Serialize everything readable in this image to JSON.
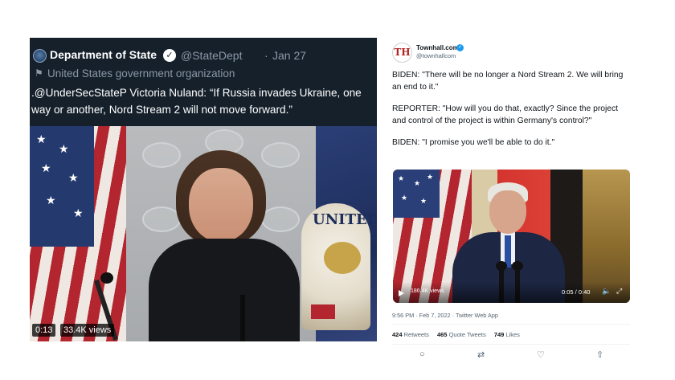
{
  "left_tweet": {
    "account_name": "Department of State",
    "verified_mark": "✓",
    "handle": "@StateDept",
    "separator": "·",
    "date": "Jan 27",
    "flag_icon": "⚑",
    "account_label": "United States government organization",
    "text": ".@UnderSecStateP Victoria Nuland: “If Russia invades Ukraine, one way or another, Nord Stream 2 will not move forward.”",
    "video": {
      "time": "0:13",
      "views": "33.4K views",
      "emblem_text": "UNITED"
    },
    "colors": {
      "background": "#15202b",
      "secondary_text": "#8b98a5"
    }
  },
  "right_tweet": {
    "avatar_letters": "TH",
    "account_name": "Townhall.com",
    "verified_mark": "✓",
    "handle": "@townhallcom",
    "paragraphs": [
      "BIDEN: \"There will be no longer a Nord Stream 2. We will bring an end to it.\"",
      "REPORTER: \"How will you do that, exactly? Since the project and control of the project is within Germany's control?\"",
      "BIDEN: \"I promise you we'll be able to do it.\""
    ],
    "video": {
      "views": "186.4K views",
      "time": "0:05 / 0:40",
      "volume_icon": "🔈",
      "fullscreen_icon": "⤢"
    },
    "meta": "9:56 PM · Feb 7, 2022 · Twitter Web App",
    "stats": {
      "retweets_count": "424",
      "retweets_label": "Retweets",
      "quotes_count": "465",
      "quotes_label": "Quote Tweets",
      "likes_count": "749",
      "likes_label": "Likes"
    },
    "actions": {
      "reply_icon": "○",
      "retweet_icon": "⇄",
      "like_icon": "♡",
      "share_icon": "⇧"
    },
    "colors": {
      "verified": "#1d9bf0",
      "secondary_text": "#536471"
    }
  }
}
